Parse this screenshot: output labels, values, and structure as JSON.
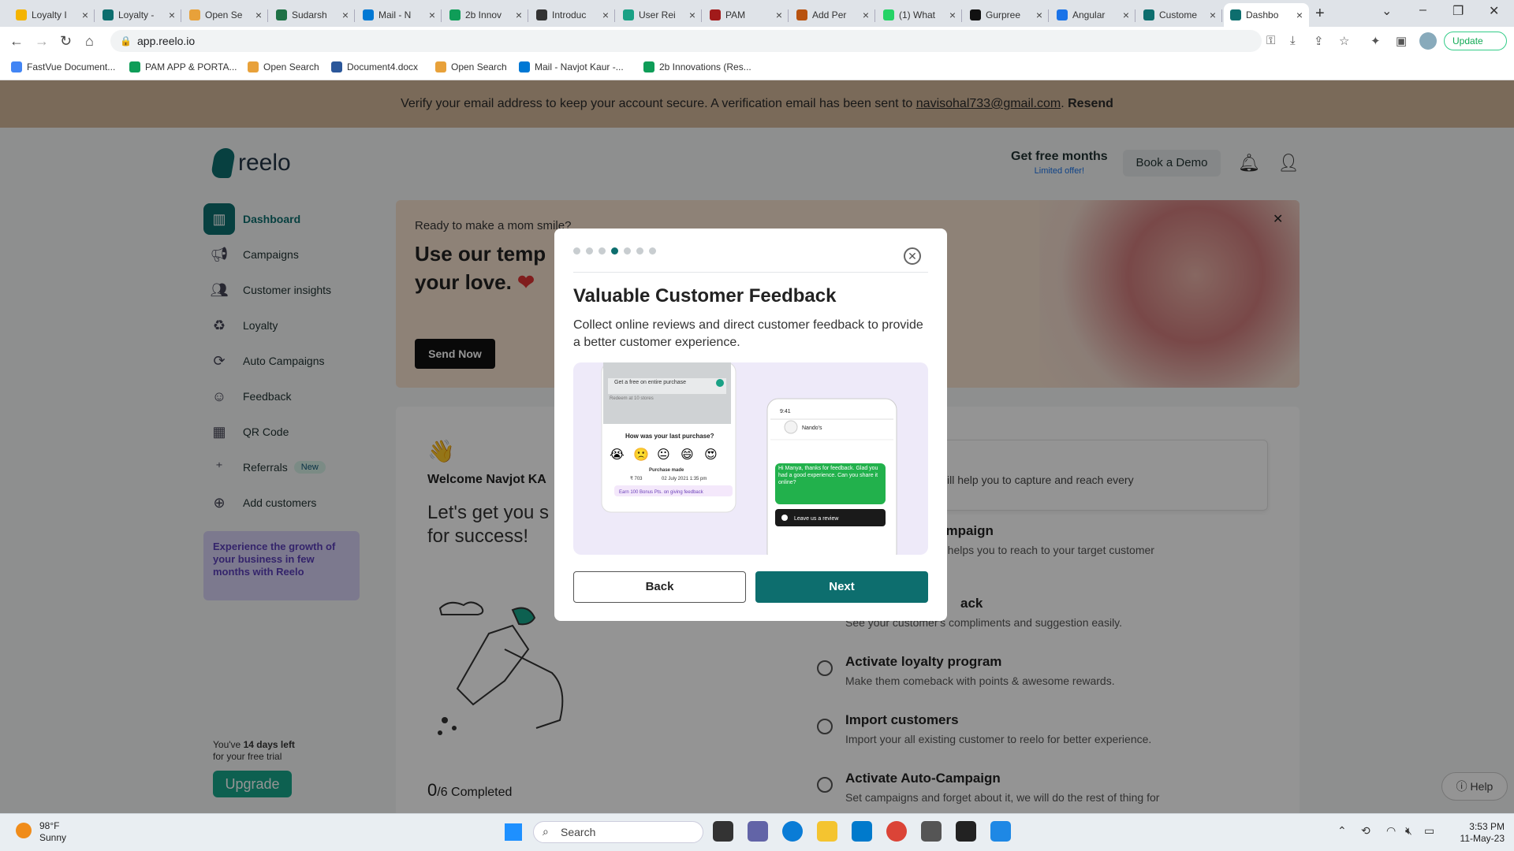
{
  "browser": {
    "tabs": [
      {
        "title": "Loyalty I",
        "fav_color": "#f4b400"
      },
      {
        "title": "Loyalty -",
        "fav_color": "#0d6e6e"
      },
      {
        "title": "Open Se",
        "fav_color": "#e8a13a"
      },
      {
        "title": "Sudarsh",
        "fav_color": "#1e7145"
      },
      {
        "title": "Mail - N",
        "fav_color": "#0078d4"
      },
      {
        "title": "2b Innov",
        "fav_color": "#0f9d58"
      },
      {
        "title": "Introduc",
        "fav_color": "#333333"
      },
      {
        "title": "User Rei",
        "fav_color": "#1aa185"
      },
      {
        "title": "PAM",
        "fav_color": "#a11a1a"
      },
      {
        "title": "Add Per",
        "fav_color": "#b8520f"
      },
      {
        "title": "(1) What",
        "fav_color": "#25d366"
      },
      {
        "title": "Gurpree",
        "fav_color": "#111111"
      },
      {
        "title": "Angular",
        "fav_color": "#1a73e8"
      },
      {
        "title": "Custome",
        "fav_color": "#0d6e6e"
      },
      {
        "title": "Dashbo",
        "fav_color": "#0d6e6e",
        "active": true
      }
    ],
    "url": "app.reelo.io",
    "update_label": "Update",
    "bookmarks": [
      "FastVue Document...",
      "PAM APP & PORTA...",
      "Open Search",
      "Document4.docx",
      "Open Search",
      "Mail - Navjot Kaur -...",
      "2b Innovations (Res..."
    ]
  },
  "verify_banner": {
    "text": "Verify your email address to keep your account secure. A verification email has been sent to",
    "email": "navisohal733@gmail.com",
    "resend": "Resend"
  },
  "header": {
    "logo_text": "reelo",
    "free_months": "Get free months",
    "limited_offer": "Limited offer!",
    "book_demo": "Book a Demo"
  },
  "sidebar": {
    "items": [
      {
        "label": "Dashboard",
        "icon": "dashboard-icon"
      },
      {
        "label": "Campaigns",
        "icon": "megaphone-icon"
      },
      {
        "label": "Customer insights",
        "icon": "users-icon"
      },
      {
        "label": "Loyalty",
        "icon": "loyalty-icon"
      },
      {
        "label": "Auto Campaigns",
        "icon": "refresh-icon"
      },
      {
        "label": "Feedback",
        "icon": "smile-icon"
      },
      {
        "label": "QR Code",
        "icon": "qr-code-icon"
      },
      {
        "label": "Referrals",
        "icon": "add-user-icon",
        "badge": "New"
      },
      {
        "label": "Add customers",
        "icon": "add-customer-icon"
      }
    ],
    "promo": "Experience the growth of your business in few months with Reelo",
    "trial_prefix": "You've",
    "trial_days": "14 days left",
    "trial_suffix": "for your free trial",
    "upgrade": "Upgrade"
  },
  "banner": {
    "kicker": "Ready to make a mom smile?",
    "title_line1": "Use our temp",
    "title_line2": "your love.",
    "send_now": "Send Now"
  },
  "welcome": {
    "title": "Welcome Navjot KA",
    "tagline_line1": "Let's get you s",
    "tagline_line2": "for success!",
    "completed_num": "0",
    "completed_rest": "/6 Completed",
    "hint": "ill help you to capture and reach every",
    "tasks": [
      {
        "title": "ampaign",
        "desc": "n helps you to reach to your target customer"
      },
      {
        "title": "ack",
        "desc": "See your customer's compliments and suggestion easily."
      },
      {
        "title": "Activate loyalty program",
        "desc": "Make them comeback with points & awesome rewards."
      },
      {
        "title": "Import customers",
        "desc": "Import your all existing customer to reelo for better experience."
      },
      {
        "title": "Activate Auto-Campaign",
        "desc": "Set campaigns and forget about it, we will do the rest of thing for"
      }
    ],
    "help": "Help"
  },
  "modal": {
    "steps_total": 7,
    "steps_active": 4,
    "title": "Valuable Customer Feedback",
    "description": "Collect online reviews and direct customer feedback to provide a better customer experience.",
    "illustration": {
      "card_offer": "Get a free on entire purchase",
      "redeem": "Redeem at 10 stores",
      "question": "How was your last purchase?",
      "purchase_made": "Purchase made",
      "amount": "₹ 703",
      "date": "02 July 2021 1:35 pm",
      "earn": "Earn 100 Bonus Pts. on giving feedback",
      "phone_time": "9:41",
      "contact": "Nando's",
      "chat": "Hi Manya, thanks for feedback. Glad you had a good experience. Can you share it online?",
      "review_btn": "Leave us a review"
    },
    "back": "Back",
    "next": "Next"
  },
  "taskbar": {
    "temp": "98°F",
    "weather": "Sunny",
    "search": "Search",
    "time": "3:53 PM",
    "date": "11-May-23"
  }
}
